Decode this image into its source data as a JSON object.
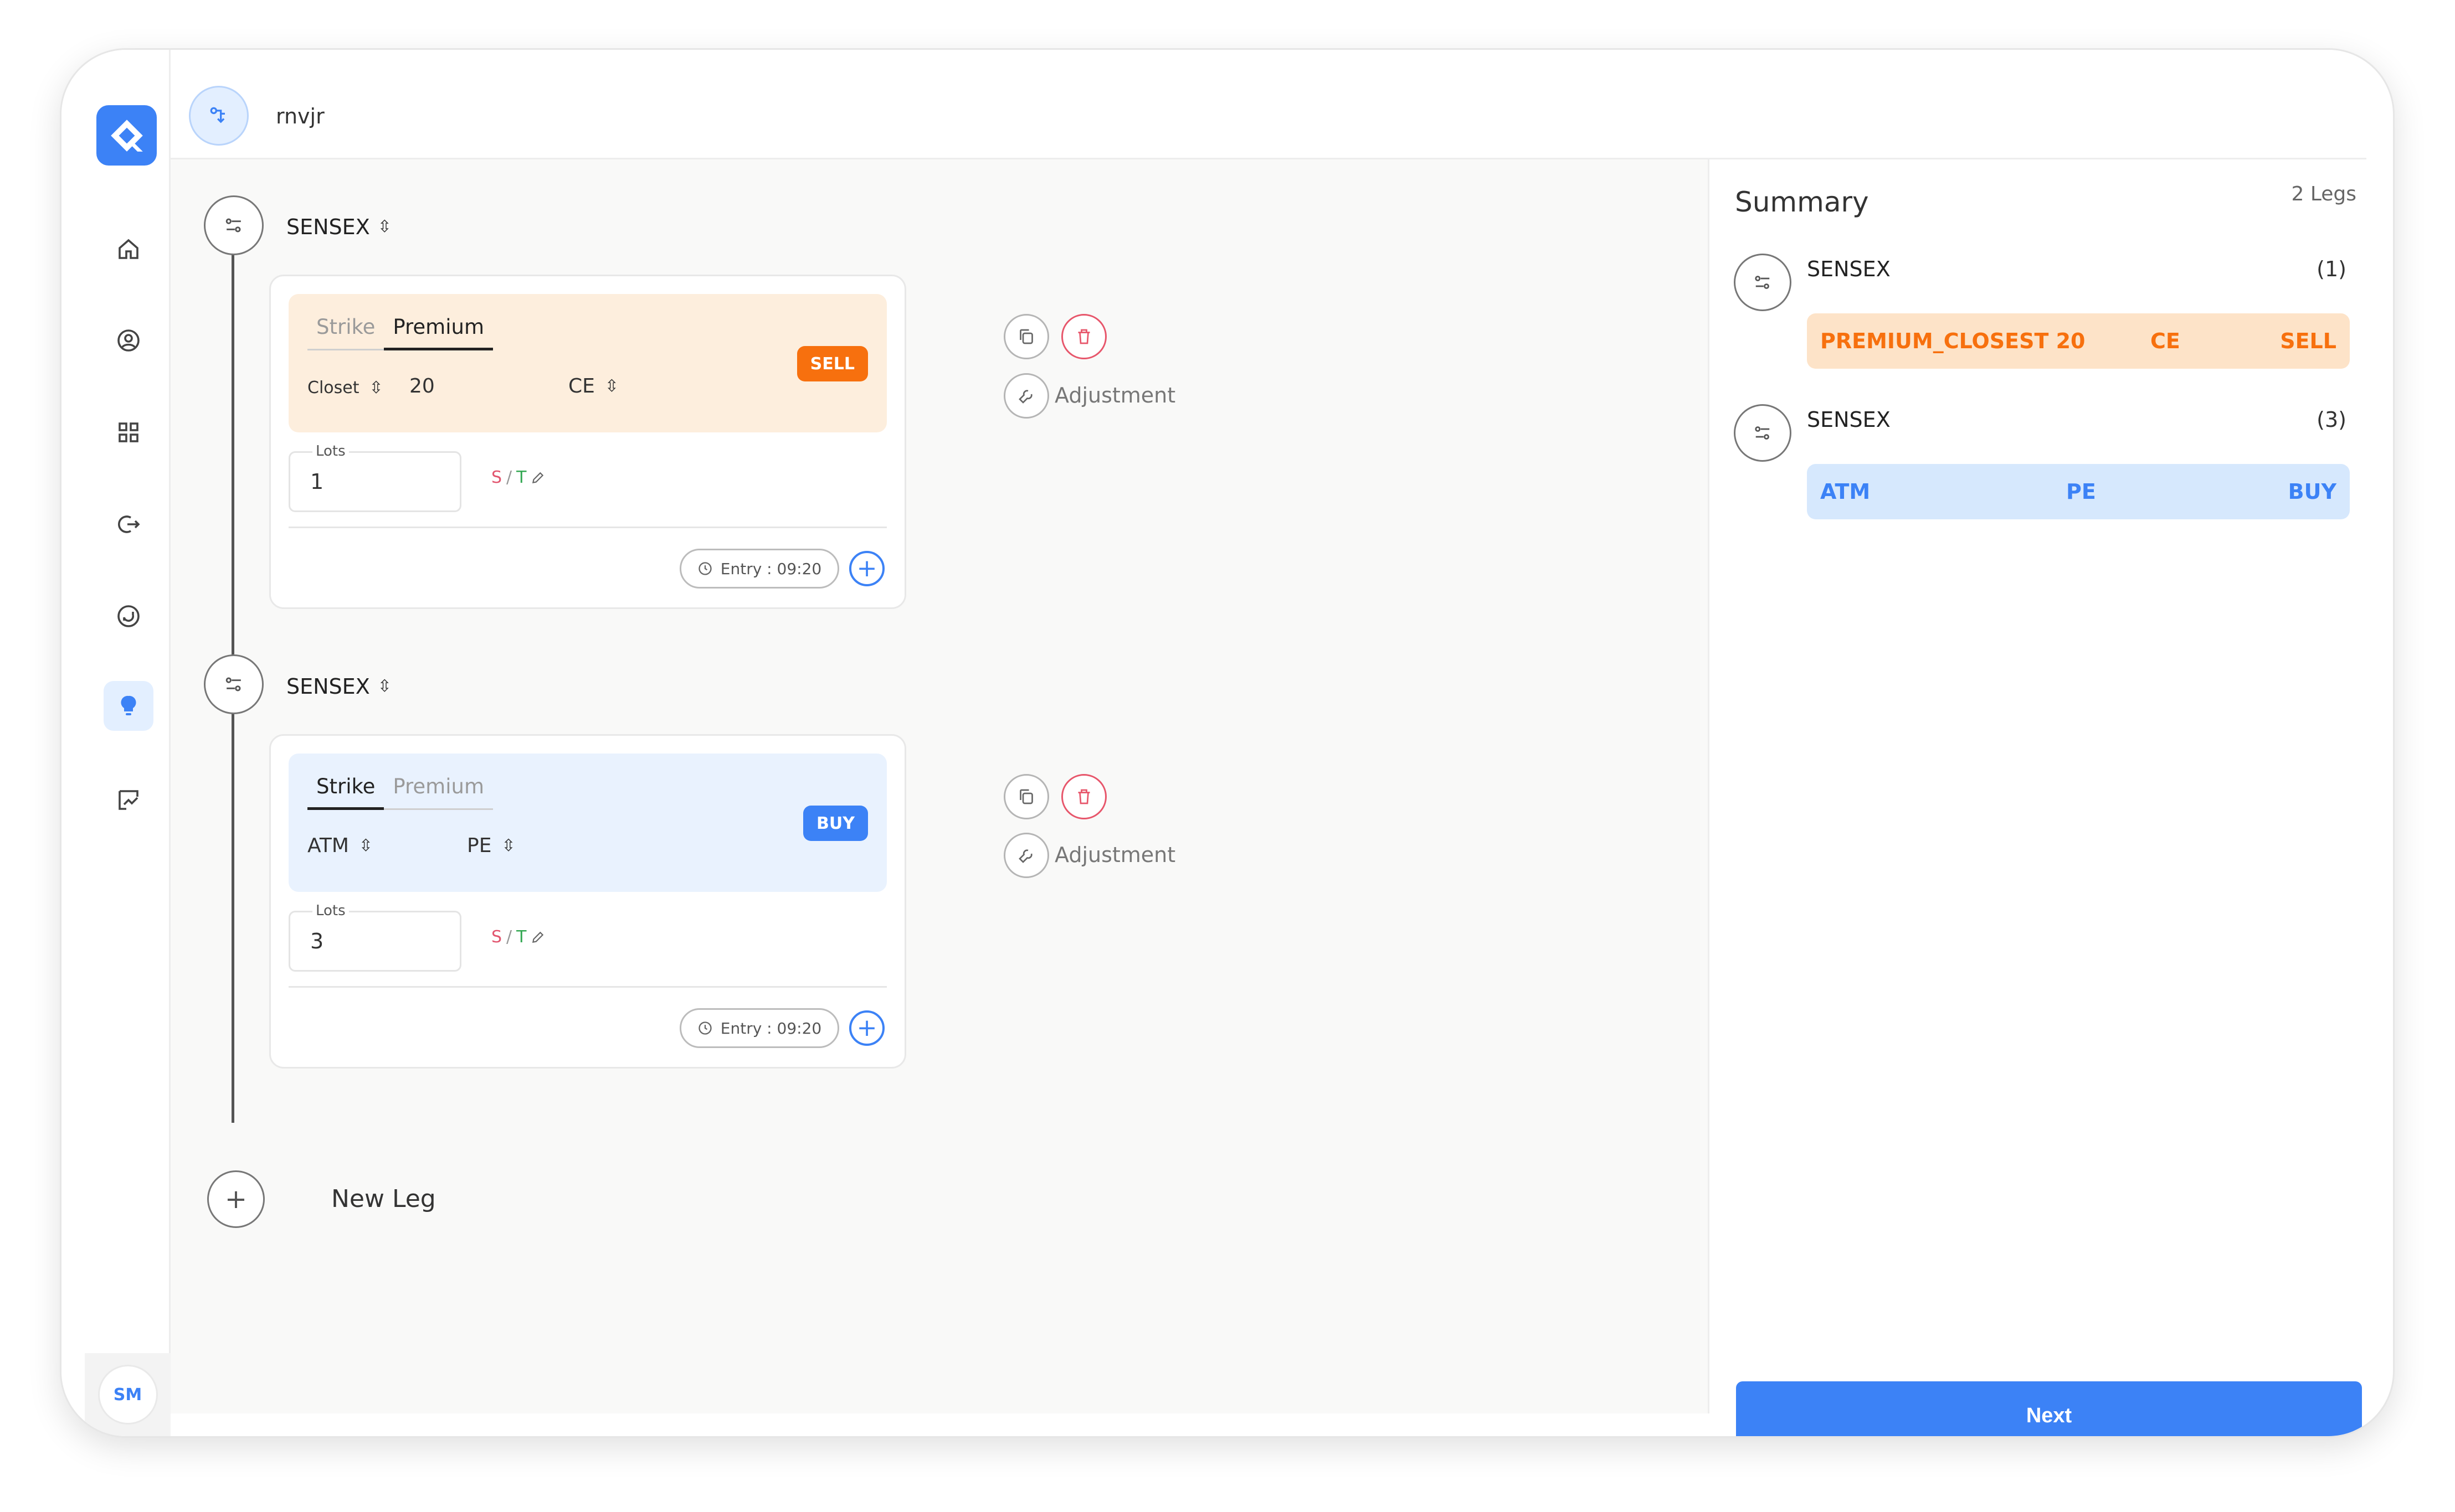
{
  "header": {
    "title": "rnvjr"
  },
  "user": {
    "initials": "SM"
  },
  "colors": {
    "accent": "#3c82f6",
    "sell": "#f7700e",
    "delete": "#e7566b"
  },
  "legs": [
    {
      "instrument": "SENSEX",
      "tabs": {
        "strike": "Strike",
        "premium": "Premium",
        "active": "premium"
      },
      "action": "SELL",
      "selector1": "Closet",
      "selector_value": "20",
      "option_type": "CE",
      "lots_label": "Lots",
      "lots_value": "1",
      "st": {
        "s": "S",
        "sep": "/",
        "t": "T"
      },
      "entry": "Entry : 09:20",
      "adjustment": "Adjustment"
    },
    {
      "instrument": "SENSEX",
      "tabs": {
        "strike": "Strike",
        "premium": "Premium",
        "active": "strike"
      },
      "action": "BUY",
      "selector1": "ATM",
      "option_type": "PE",
      "lots_label": "Lots",
      "lots_value": "3",
      "st": {
        "s": "S",
        "sep": "/",
        "t": "T"
      },
      "entry": "Entry : 09:20",
      "adjustment": "Adjustment"
    }
  ],
  "new_leg": {
    "label": "New Leg"
  },
  "summary": {
    "title": "Summary",
    "count": "2 Legs",
    "items": [
      {
        "instrument": "SENSEX",
        "qty": "(1)",
        "col1": "PREMIUM_CLOSEST 20",
        "col2": "CE",
        "col3": "SELL"
      },
      {
        "instrument": "SENSEX",
        "qty": "(3)",
        "col1": "ATM",
        "col2": "PE",
        "col3": "BUY"
      }
    ],
    "next_label": "Next"
  }
}
